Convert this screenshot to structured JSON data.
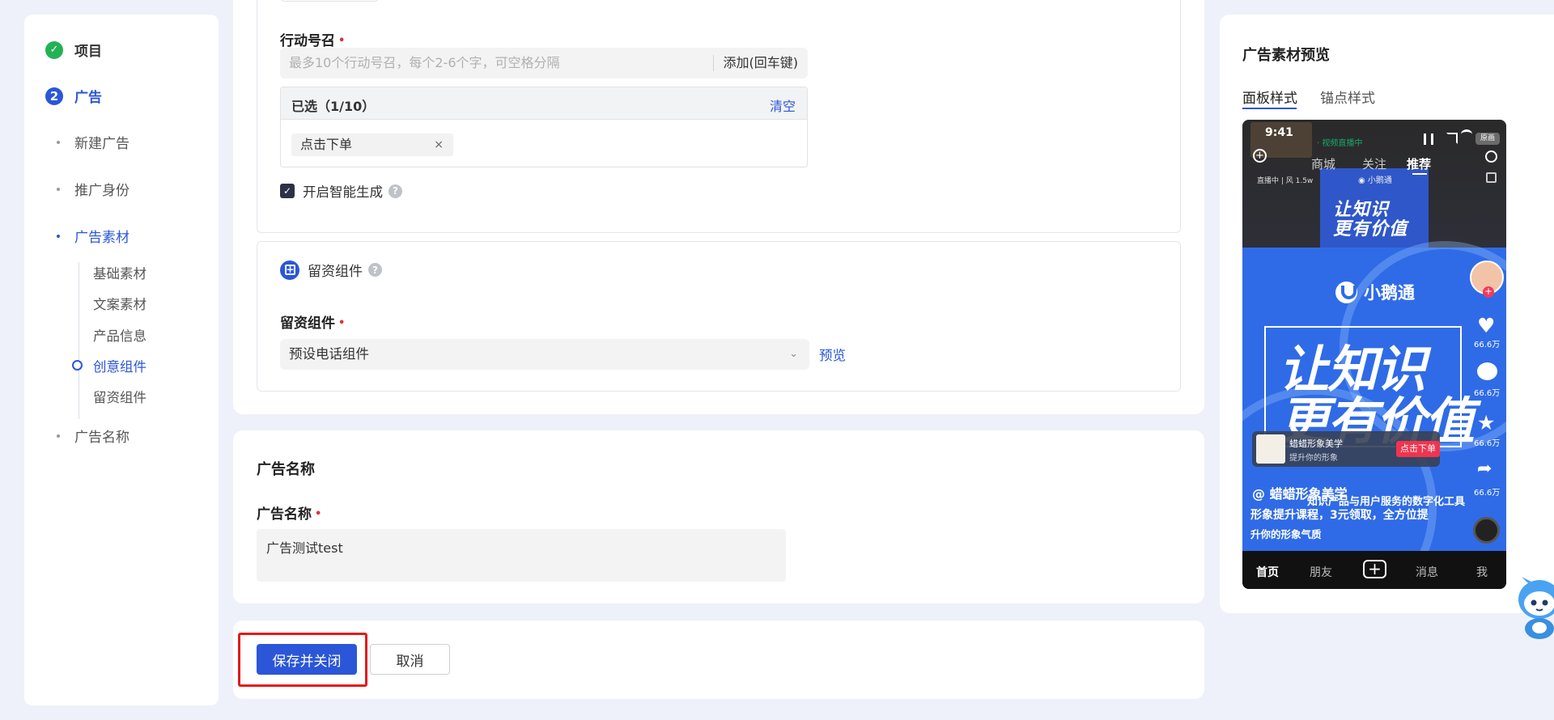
{
  "sidebar": {
    "steps": [
      {
        "label": "项目",
        "icon": "✓"
      },
      {
        "label": "广告",
        "icon": "2"
      }
    ],
    "sub_items": [
      "新建广告",
      "推广身份",
      "广告素材",
      "广告名称"
    ],
    "material_items": [
      "基础素材",
      "文案素材",
      "产品信息",
      "创意组件",
      "留资组件"
    ]
  },
  "cta": {
    "label": "行动号召",
    "required_mark": "•",
    "placeholder": "最多10个行动号召，每个2-6个字，可空格分隔",
    "add_label": "添加(回车键)",
    "selected_title": "已选（1/10）",
    "clear_label": "清空",
    "tags": [
      "点击下单"
    ],
    "tag_remove": "×",
    "smart_label": "开启智能生成",
    "check_mark": "✓",
    "help": "?"
  },
  "lead": {
    "section_title": "留资组件",
    "help": "?",
    "label": "留资组件",
    "required_mark": "•",
    "value": "预设电话组件",
    "chevron": "⌄",
    "preview_link": "预览"
  },
  "ad_name": {
    "section_title": "广告名称",
    "label": "广告名称",
    "required_mark": "•",
    "value": "广告测试test"
  },
  "footer": {
    "save_label": "保存并关闭",
    "cancel_label": "取消"
  },
  "preview": {
    "title": "广告素材预览",
    "tabs": [
      "面板样式",
      "锚点样式"
    ],
    "phone": {
      "time": "9:41",
      "live_tag": "· 视频直播中",
      "badge": "原画",
      "nav": [
        "商城",
        "关注",
        "推荐"
      ],
      "viewer_info": "直播中 | 风 1.5w",
      "brand_small": "◉ 小鹅通",
      "top_art": "让知识\n更有价值",
      "brand": "小鹅通",
      "big_text": "让知识\n更有价值",
      "likes": [
        "66.6万",
        "66.6万",
        "66.6万",
        "66.6万"
      ],
      "card_title": "蜡蜡形象美学",
      "card_sub": "提升你的形象",
      "card_button": "点击下单",
      "author": "@ 蜡蜡形象美学",
      "desc1": "知识产品与用户服务的数字化工具",
      "desc2": "形象提升课程，3元领取，全方位提",
      "desc3": "升你的形象气质",
      "bottom_nav": [
        "首页",
        "朋友",
        "消息",
        "我"
      ],
      "plus": "+",
      "follow": "+"
    }
  },
  "colors": {
    "primary": "#2b56d8",
    "success": "#23b255",
    "required": "#e0303e",
    "highlight": "#e51a1a"
  }
}
